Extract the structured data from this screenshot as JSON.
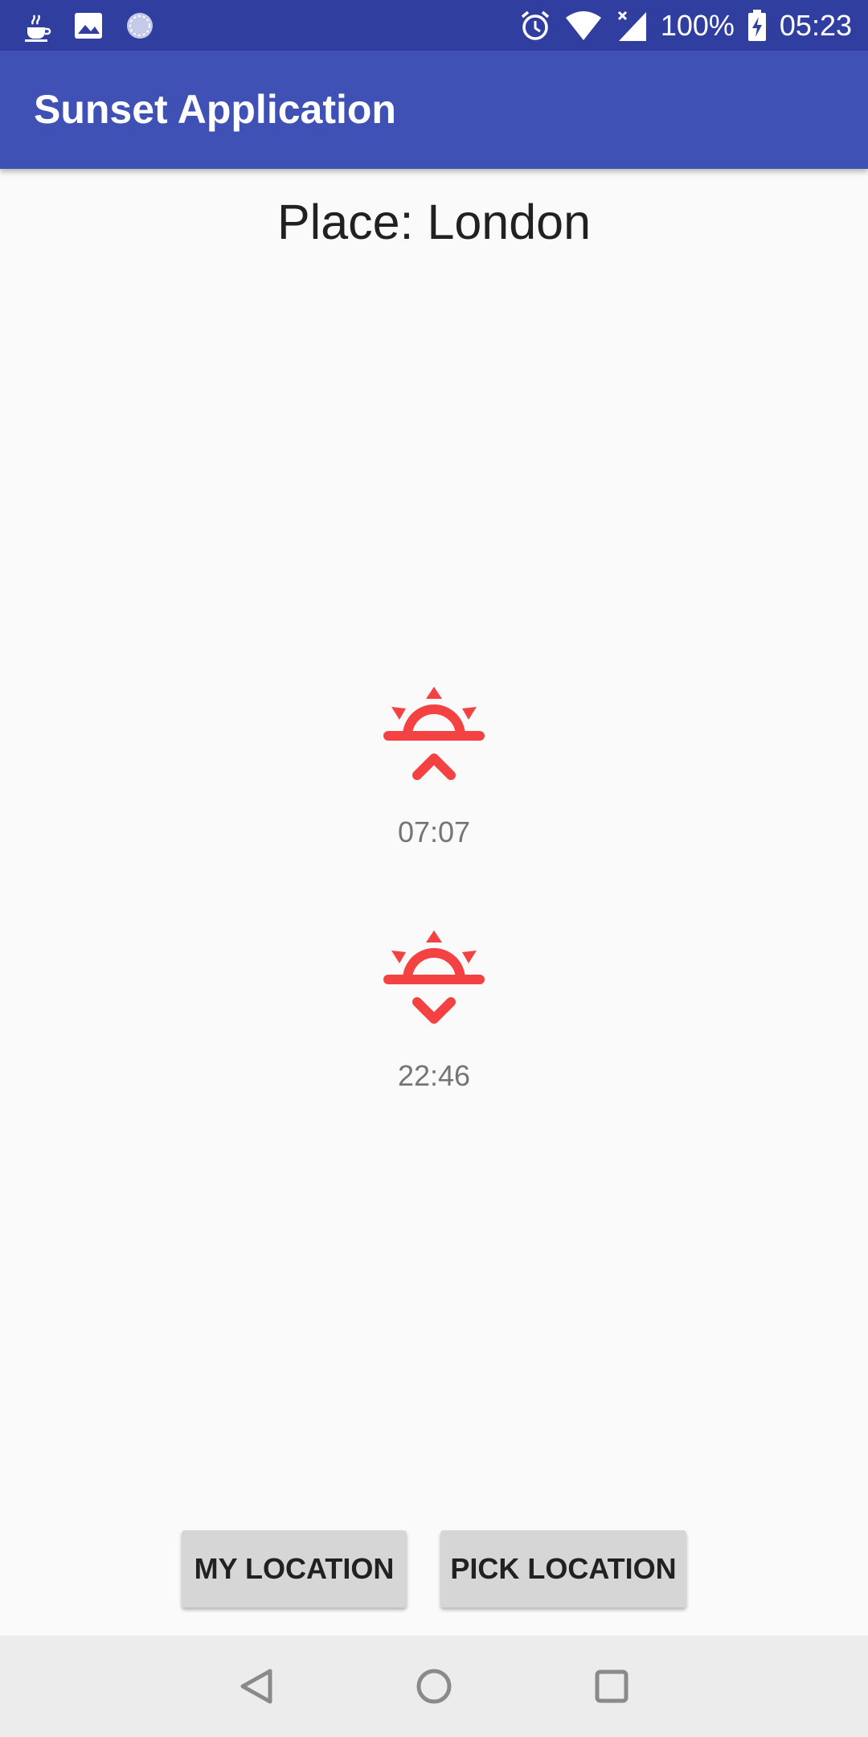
{
  "status_bar": {
    "battery": "100%",
    "time": "05:23",
    "left_icons": [
      "java-icon",
      "image-icon",
      "sync-spinner-icon"
    ],
    "right_icons": [
      "alarm-icon",
      "wifi-icon",
      "cellular-signal-icon",
      "battery-charging-icon"
    ]
  },
  "app_bar": {
    "title": "Sunset Application"
  },
  "main": {
    "place": "Place: London",
    "sunrise": {
      "icon": "sunrise-icon",
      "time": "07:07"
    },
    "sunset": {
      "icon": "sunset-icon",
      "time": "22:46"
    }
  },
  "buttons": {
    "my_location": "MY LOCATION",
    "pick_location": "PICK LOCATION"
  },
  "navigation": {
    "items": [
      "back-icon",
      "home-icon",
      "recents-icon"
    ]
  },
  "colors": {
    "status_bar": "#303f9f",
    "app_bar": "#3f51b5",
    "sun_icon": "#f44242",
    "button": "#d6d6d6",
    "nav_bar": "#ececec"
  }
}
